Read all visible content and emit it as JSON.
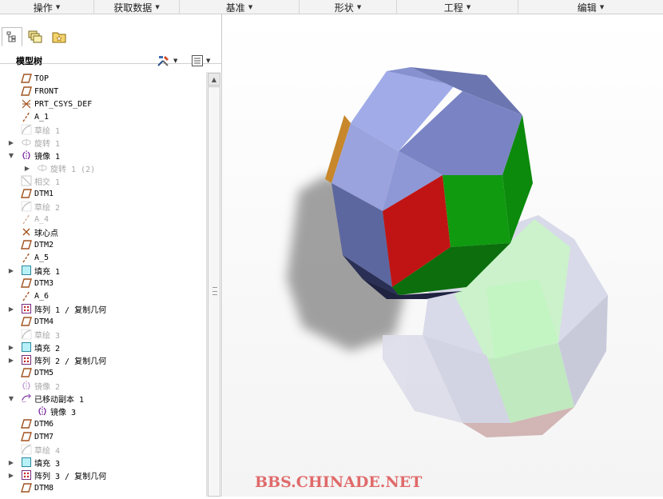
{
  "ribbon": {
    "tabs": [
      "操作",
      "获取数据",
      "基准",
      "形状",
      "工程",
      "编辑"
    ]
  },
  "panel": {
    "tree_title": "模型树",
    "tabs": [
      "model-tree-icon",
      "layers-icon",
      "folder-star-icon"
    ]
  },
  "tree": {
    "items": [
      {
        "label": "TOP",
        "icon": "datum-plane-icon",
        "dim": false
      },
      {
        "label": "FRONT",
        "icon": "datum-plane-icon",
        "dim": false
      },
      {
        "label": "PRT_CSYS_DEF",
        "icon": "csys-icon",
        "dim": false
      },
      {
        "label": "A_1",
        "icon": "axis-icon",
        "dim": false
      },
      {
        "label": "草绘 1",
        "icon": "sketch-icon",
        "dim": true
      },
      {
        "label": "旋转 1",
        "icon": "revolve-icon",
        "dim": true,
        "expand": true
      },
      {
        "label": "镜像 1",
        "icon": "mirror-icon",
        "dim": false,
        "expand": "open"
      },
      {
        "label": "旋转 1 (2)",
        "icon": "revolve-icon",
        "dim": true,
        "expand": true,
        "indent": 1
      },
      {
        "label": "相交 1",
        "icon": "intersect-icon",
        "dim": true
      },
      {
        "label": "DTM1",
        "icon": "datum-plane-icon",
        "dim": false
      },
      {
        "label": "草绘 2",
        "icon": "sketch-icon",
        "dim": true
      },
      {
        "label": "A_4",
        "icon": "axis-icon",
        "dim": true
      },
      {
        "label": "球心点",
        "icon": "point-icon",
        "dim": false
      },
      {
        "label": "DTM2",
        "icon": "datum-plane-icon",
        "dim": false
      },
      {
        "label": "A_5",
        "icon": "axis-icon",
        "dim": false
      },
      {
        "label": "填充 1",
        "icon": "fill-icon",
        "dim": false,
        "expand": true
      },
      {
        "label": "DTM3",
        "icon": "datum-plane-icon",
        "dim": false
      },
      {
        "label": "A_6",
        "icon": "axis-icon",
        "dim": false
      },
      {
        "label": "阵列 1 / 复制几何",
        "icon": "pattern-icon",
        "dim": false,
        "expand": true
      },
      {
        "label": "DTM4",
        "icon": "datum-plane-icon",
        "dim": false
      },
      {
        "label": "草绘 3",
        "icon": "sketch-icon",
        "dim": true
      },
      {
        "label": "填充 2",
        "icon": "fill-icon",
        "dim": false,
        "expand": true
      },
      {
        "label": "阵列 2 / 复制几何",
        "icon": "pattern-icon",
        "dim": false,
        "expand": true
      },
      {
        "label": "DTM5",
        "icon": "datum-plane-icon",
        "dim": false
      },
      {
        "label": "镜像 2",
        "icon": "mirror-icon",
        "dim": true
      },
      {
        "label": "已移动副本 1",
        "icon": "moved-copy-icon",
        "dim": false,
        "expand": "open"
      },
      {
        "label": "镜像 3",
        "icon": "mirror-icon",
        "dim": false,
        "indent": 1
      },
      {
        "label": "DTM6",
        "icon": "datum-plane-icon",
        "dim": false
      },
      {
        "label": "DTM7",
        "icon": "datum-plane-icon",
        "dim": false
      },
      {
        "label": "草绘 4",
        "icon": "sketch-icon",
        "dim": true
      },
      {
        "label": "填充 3",
        "icon": "fill-icon",
        "dim": false,
        "expand": true
      },
      {
        "label": "阵列 3 / 复制几何",
        "icon": "pattern-icon",
        "dim": false,
        "expand": true
      },
      {
        "label": "DTM8",
        "icon": "datum-plane-icon",
        "dim": false
      }
    ]
  },
  "viewport": {
    "watermark": "BBS.CHINADE.NET"
  },
  "colors": {
    "face_blue": "#7f8cd0",
    "face_red": "#c01414",
    "face_green": "#109a10",
    "face_light_green": "#bff0bf",
    "face_light_blue": "#d4d6e6",
    "edge_orange": "#c8872a",
    "watermark": "#e06a6a"
  }
}
